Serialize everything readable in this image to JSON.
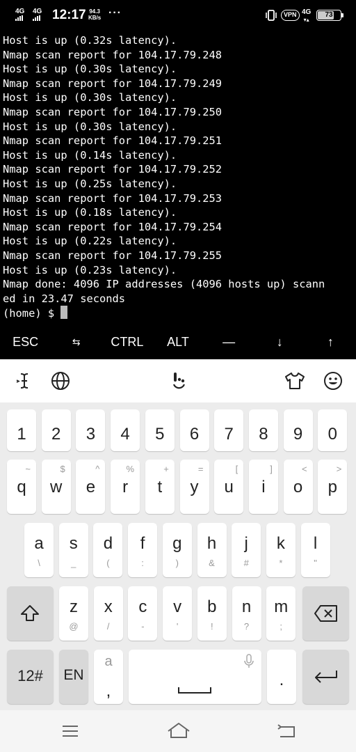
{
  "status_bar": {
    "network1": "4G",
    "network2": "4G",
    "time": "12:17",
    "speed_value": "94.3",
    "speed_unit": "KB/s",
    "more": "···",
    "vpn": "VPN",
    "network3": "4G",
    "battery_level": "73",
    "battery_percent": 73
  },
  "terminal": {
    "lines": [
      "Host is up (0.32s latency).",
      "Nmap scan report for 104.17.79.248",
      "Host is up (0.30s latency).",
      "Nmap scan report for 104.17.79.249",
      "Host is up (0.30s latency).",
      "Nmap scan report for 104.17.79.250",
      "Host is up (0.30s latency).",
      "Nmap scan report for 104.17.79.251",
      "Host is up (0.14s latency).",
      "Nmap scan report for 104.17.79.252",
      "Host is up (0.25s latency).",
      "Nmap scan report for 104.17.79.253",
      "Host is up (0.18s latency).",
      "Nmap scan report for 104.17.79.254",
      "Host is up (0.22s latency).",
      "Nmap scan report for 104.17.79.255",
      "Host is up (0.23s latency).",
      "Nmap done: 4096 IP addresses (4096 hosts up) scann",
      "ed in 23.47 seconds"
    ],
    "prompt": "(home) $ "
  },
  "extra_keys": [
    "ESC",
    "⇆",
    "CTRL",
    "ALT",
    "—",
    "↓",
    "↑"
  ],
  "keyboard": {
    "number_row": [
      "1",
      "2",
      "3",
      "4",
      "5",
      "6",
      "7",
      "8",
      "9",
      "0"
    ],
    "row1": [
      {
        "key": "q",
        "hint": "~"
      },
      {
        "key": "w",
        "hint": "$"
      },
      {
        "key": "e",
        "hint": "^"
      },
      {
        "key": "r",
        "hint": "%"
      },
      {
        "key": "t",
        "hint": "+"
      },
      {
        "key": "y",
        "hint": "="
      },
      {
        "key": "u",
        "hint": "["
      },
      {
        "key": "i",
        "hint": "]"
      },
      {
        "key": "o",
        "hint": "<"
      },
      {
        "key": "p",
        "hint": ">"
      }
    ],
    "row2": [
      {
        "key": "a",
        "hint": "\\"
      },
      {
        "key": "s",
        "hint": "_"
      },
      {
        "key": "d",
        "hint": "("
      },
      {
        "key": "f",
        "hint": ":"
      },
      {
        "key": "g",
        "hint": ")"
      },
      {
        "key": "h",
        "hint": "&"
      },
      {
        "key": "j",
        "hint": "#"
      },
      {
        "key": "k",
        "hint": "*"
      },
      {
        "key": "l",
        "hint": "\""
      }
    ],
    "row3": [
      {
        "key": "z",
        "hint": "@"
      },
      {
        "key": "x",
        "hint": "/"
      },
      {
        "key": "c",
        "hint": "-"
      },
      {
        "key": "v",
        "hint": "'"
      },
      {
        "key": "b",
        "hint": "!"
      },
      {
        "key": "n",
        "hint": "?"
      },
      {
        "key": "m",
        "hint": ";"
      }
    ],
    "symbols_key": "12#",
    "lang_key": "EN",
    "comma_key": ",",
    "comma_hint": "a",
    "period_key": "."
  },
  "colors": {
    "terminal_bg": "#000000",
    "terminal_fg": "#ffffff",
    "keyboard_bg": "#ececec",
    "key_bg": "#ffffff",
    "key_dark_bg": "#d8d8d8"
  }
}
